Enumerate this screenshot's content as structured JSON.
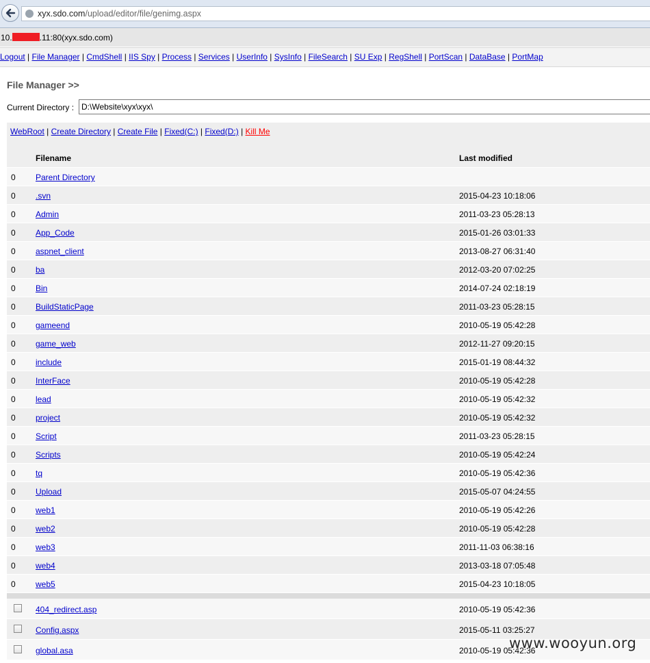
{
  "browser": {
    "url_host": "xyx.sdo.com",
    "url_path": "/upload/editor/file/genimg.aspx"
  },
  "server": {
    "prefix": "10.",
    "suffix": ".11:80(xyx.sdo.com)"
  },
  "menu": [
    "Logout",
    "File Manager",
    "CmdShell",
    "IIS Spy",
    "Process",
    "Services",
    "UserInfo",
    "SysInfo",
    "FileSearch",
    "SU Exp",
    "RegShell",
    "PortScan",
    "DataBase",
    "PortMap"
  ],
  "page_title": "File Manager >>",
  "current_directory": {
    "label": "Current Directory :",
    "value": "D:\\Website\\xyx\\xyx\\"
  },
  "actions": [
    "WebRoot",
    "Create Directory",
    "Create File",
    "Fixed(C:)",
    "Fixed(D:)"
  ],
  "kill_label": "Kill Me",
  "colors": {
    "link": "#0000cc",
    "danger": "#ff0000",
    "redaction": "#ef1d24"
  },
  "table": {
    "header_filename": "Filename",
    "header_modified": "Last modified",
    "directories": [
      {
        "num": "0",
        "name": "Parent Directory",
        "modified": ""
      },
      {
        "num": "0",
        "name": ".svn",
        "modified": "2015-04-23 10:18:06"
      },
      {
        "num": "0",
        "name": "Admin",
        "modified": "2011-03-23 05:28:13"
      },
      {
        "num": "0",
        "name": "App_Code",
        "modified": "2015-01-26 03:01:33"
      },
      {
        "num": "0",
        "name": "aspnet_client",
        "modified": "2013-08-27 06:31:40"
      },
      {
        "num": "0",
        "name": "ba",
        "modified": "2012-03-20 07:02:25"
      },
      {
        "num": "0",
        "name": "Bin",
        "modified": "2014-07-24 02:18:19"
      },
      {
        "num": "0",
        "name": "BuildStaticPage",
        "modified": "2011-03-23 05:28:15"
      },
      {
        "num": "0",
        "name": "gameend",
        "modified": "2010-05-19 05:42:28"
      },
      {
        "num": "0",
        "name": "game_web",
        "modified": "2012-11-27 09:20:15"
      },
      {
        "num": "0",
        "name": "include",
        "modified": "2015-01-19 08:44:32"
      },
      {
        "num": "0",
        "name": "InterFace",
        "modified": "2010-05-19 05:42:28"
      },
      {
        "num": "0",
        "name": "lead",
        "modified": "2010-05-19 05:42:32"
      },
      {
        "num": "0",
        "name": "project",
        "modified": "2010-05-19 05:42:32"
      },
      {
        "num": "0",
        "name": "Script",
        "modified": "2011-03-23 05:28:15"
      },
      {
        "num": "0",
        "name": "Scripts",
        "modified": "2010-05-19 05:42:24"
      },
      {
        "num": "0",
        "name": "tq",
        "modified": "2010-05-19 05:42:36"
      },
      {
        "num": "0",
        "name": "Upload",
        "modified": "2015-05-07 04:24:55"
      },
      {
        "num": "0",
        "name": "web1",
        "modified": "2010-05-19 05:42:26"
      },
      {
        "num": "0",
        "name": "web2",
        "modified": "2010-05-19 05:42:28"
      },
      {
        "num": "0",
        "name": "web3",
        "modified": "2011-11-03 06:38:16"
      },
      {
        "num": "0",
        "name": "web4",
        "modified": "2013-03-18 07:05:48"
      },
      {
        "num": "0",
        "name": "web5",
        "modified": "2015-04-23 10:18:05"
      }
    ],
    "files": [
      {
        "name": "404_redirect.asp",
        "modified": "2010-05-19 05:42:36"
      },
      {
        "name": "Config.aspx",
        "modified": "2015-05-11 03:25:27"
      },
      {
        "name": "global.asa",
        "modified": "2010-05-19 05:42:36"
      }
    ]
  },
  "watermark": "www.wooyun.org"
}
